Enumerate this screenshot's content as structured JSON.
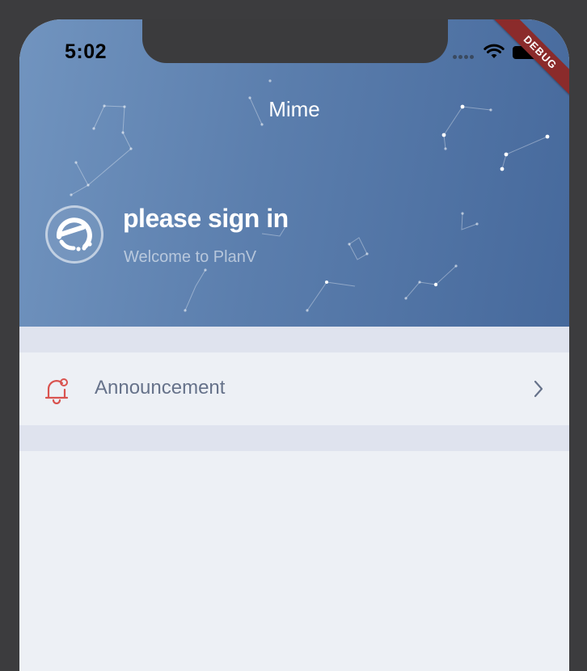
{
  "status_bar": {
    "time": "5:02",
    "icons": [
      "signal-icon",
      "wifi-icon",
      "battery-icon"
    ]
  },
  "debug_banner": "DEBUG",
  "header": {
    "title": "Mime",
    "user_name": "please sign in",
    "welcome": "Welcome to PlanV",
    "avatar_icon": "planv-logo-icon"
  },
  "menu": {
    "items": [
      {
        "label": "Announcement",
        "icon": "bell-icon",
        "trailing": "chevron-right-icon"
      }
    ]
  },
  "colors": {
    "header_gradient": [
      "#7194bf",
      "#46699c"
    ],
    "bell": "#d9534f",
    "label": "#66728a",
    "background": "#edf0f5",
    "divider": "#dfe3ee",
    "debug": "#8b2b2b"
  }
}
